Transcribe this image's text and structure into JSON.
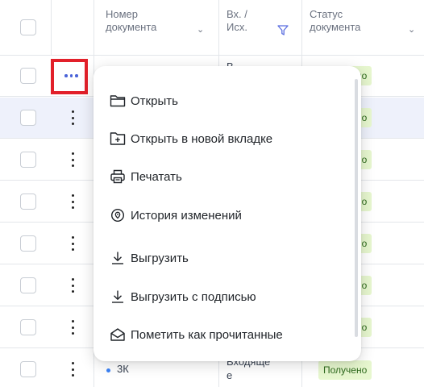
{
  "header": {
    "doc_number": "Номер документа",
    "direction": "Вх. / Исх.",
    "status": "Статус документа",
    "sort_icon": "chevron-down-icon",
    "filter_icon": "funnel-icon"
  },
  "rows": [
    {
      "status": "Получено"
    },
    {
      "status": "Получено"
    },
    {
      "status": "Получено"
    },
    {
      "status": "Получено"
    },
    {
      "status": "Получено"
    },
    {
      "status": "Получено"
    },
    {
      "status": "Получено"
    },
    {
      "doc_number": "3К",
      "direction": "Входящее",
      "status": "Получено"
    }
  ],
  "context_menu": {
    "items": [
      {
        "label": "Открыть",
        "icon": "folder-icon"
      },
      {
        "label": "Открыть в новой вкладке",
        "icon": "new-tab-icon"
      },
      {
        "label": "Печатать",
        "icon": "printer-icon"
      },
      {
        "label": "История изменений",
        "icon": "location-pin-icon"
      },
      {
        "label": "Выгрузить",
        "icon": "download-icon"
      },
      {
        "label": "Выгрузить с подписью",
        "icon": "download-icon"
      },
      {
        "label": "Пометить как прочитанные",
        "icon": "open-envelope-icon"
      }
    ]
  },
  "colors": {
    "accent": "#4a63d8",
    "highlight_box": "#e2202a",
    "status_bg": "#e7f7cf",
    "status_text": "#2f6b1e",
    "selected_row": "#eef1fb"
  }
}
